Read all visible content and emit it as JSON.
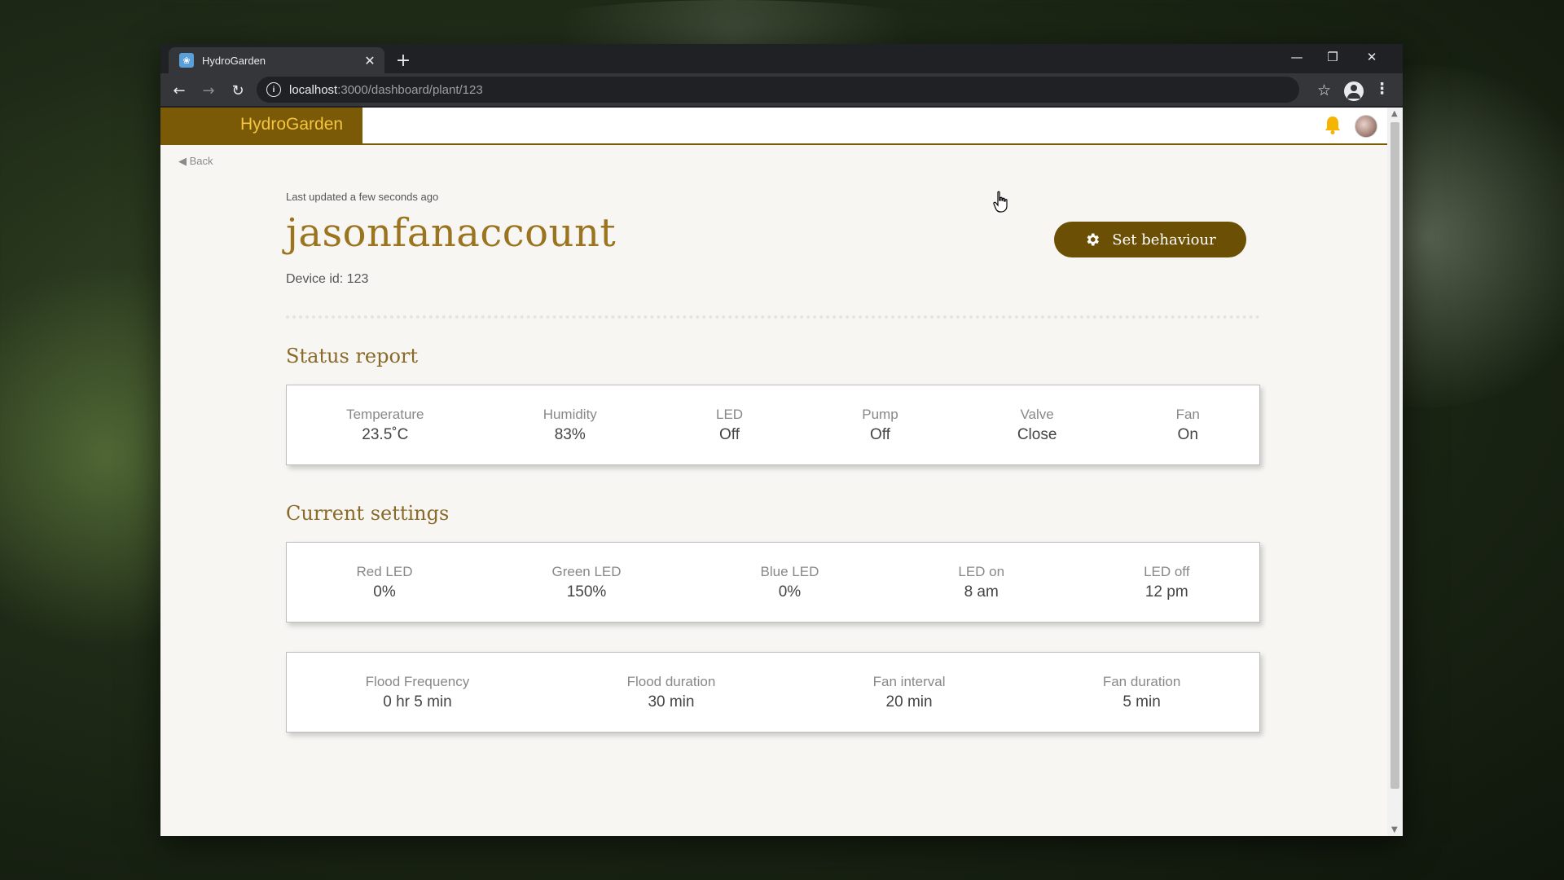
{
  "browser": {
    "tab_title": "HydroGarden",
    "url_host": "localhost",
    "url_path": ":3000/dashboard/plant/123"
  },
  "header": {
    "brand": "HydroGarden",
    "brand_color": "#7a5a06",
    "brand_text_color": "#f4c542"
  },
  "back_label": "◀ Back",
  "plant": {
    "updated": "Last updated a few seconds ago",
    "name": "jasonfanaccount",
    "device_id": "Device id: 123",
    "behaviour_button": "Set behaviour"
  },
  "status_report": {
    "title": "Status report",
    "items": [
      {
        "label": "Temperature",
        "value": "23.5˚C"
      },
      {
        "label": "Humidity",
        "value": "83%"
      },
      {
        "label": "LED",
        "value": "Off"
      },
      {
        "label": "Pump",
        "value": "Off"
      },
      {
        "label": "Valve",
        "value": "Close"
      },
      {
        "label": "Fan",
        "value": "On"
      }
    ]
  },
  "current_settings": {
    "title": "Current settings",
    "led_items": [
      {
        "label": "Red LED",
        "value": "0%"
      },
      {
        "label": "Green LED",
        "value": "150%"
      },
      {
        "label": "Blue LED",
        "value": "0%"
      },
      {
        "label": "LED on",
        "value": "8 am"
      },
      {
        "label": "LED off",
        "value": "12 pm"
      }
    ],
    "flood_items": [
      {
        "label": "Flood Frequency",
        "value": "0 hr 5 min"
      },
      {
        "label": "Flood duration",
        "value": "30 min"
      },
      {
        "label": "Fan interval",
        "value": "20 min"
      },
      {
        "label": "Fan duration",
        "value": "5 min"
      }
    ]
  }
}
